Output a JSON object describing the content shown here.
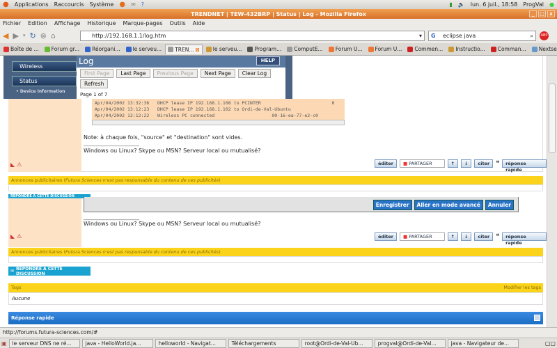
{
  "top_panel": {
    "menus": [
      "Applications",
      "Raccourcis",
      "Système"
    ],
    "clock": "lun.  6 juil., 18:58",
    "user": "ProgVal"
  },
  "window": {
    "title": "TRENDNET | TEW-432BRP | Status | Log - Mozilla Firefox"
  },
  "menubar": [
    "Fichier",
    "Edition",
    "Affichage",
    "Historique",
    "Marque-pages",
    "Outils",
    "Aide"
  ],
  "navbar": {
    "url": "http://192.168.1.1/log.htm",
    "search_value": "eclipse java"
  },
  "tabs": [
    {
      "label": "Boîte de ...",
      "color": "#d33"
    },
    {
      "label": "Forum gr...",
      "color": "#6b3"
    },
    {
      "label": "Réorgani...",
      "color": "#36c"
    },
    {
      "label": "le serveu...",
      "color": "#36c"
    },
    {
      "label": "TREN...",
      "color": "#999",
      "active": true
    },
    {
      "label": "le serveu...",
      "color": "#c93"
    },
    {
      "label": "Program...",
      "color": "#555"
    },
    {
      "label": "ComputE...",
      "color": "#999"
    },
    {
      "label": "Forum U...",
      "color": "#e73"
    },
    {
      "label": "Forum U...",
      "color": "#e73"
    },
    {
      "label": "Commen...",
      "color": "#c22"
    },
    {
      "label": "Instructio...",
      "color": "#c93"
    },
    {
      "label": "Comman...",
      "color": "#c22"
    },
    {
      "label": "Nextsend",
      "color": "#69c"
    }
  ],
  "router": {
    "nav": [
      "Wireless",
      "Status"
    ],
    "subnav": "• Device Information",
    "header": "Log",
    "help": "HELP",
    "buttons": [
      {
        "label": "First Page",
        "disabled": true
      },
      {
        "label": "Last Page"
      },
      {
        "label": "Previous Page",
        "disabled": true
      },
      {
        "label": "Next Page"
      },
      {
        "label": "Clear Log"
      },
      {
        "label": "Refresh"
      }
    ],
    "page_info": "Page 1 of 7"
  },
  "log_lines": [
    "Apr/04/2002 13:32:36   DHCP lease IP 192.168.1.108 to PCINTER                          0",
    "Apr/04/2002 13:12:23   DHCP lease IP 192.168.1.102 to Ordi-de-Val-Ubuntu",
    "Apr/04/2002 13:12:22   Wireless PC connected                     00-16-ea-77-e2-c0"
  ],
  "post1": {
    "note": "Note: à chaque fois, \"source\" et \"destination\" sont vides.",
    "signature_sep": "____________________",
    "signature": "Windows ou Linux? Skype ou MSN? Serveur local ou mutualisé?"
  },
  "post_actions": {
    "edit": "éditer",
    "share": "PARTAGER",
    "quote": "citer",
    "quick_reply": "réponse rapide"
  },
  "ads": {
    "label": "Annonces publicitaires (",
    "italic": "Futura Sciences n'est pas responsable du contenu de ces publicités",
    "close": ")"
  },
  "editor": {
    "save": "Enregistrer",
    "advanced": "Aller en mode avancé",
    "cancel": "Annuler"
  },
  "reply_button": "RÉPONDRE À CETTE DISCUSSION",
  "tags": {
    "title": "Tags",
    "edit": "Modifier les tags",
    "value": "Aucune"
  },
  "quick_reply_bar": "Réponse rapide",
  "statusbar": "http://forums.futura-sciences.com/#",
  "taskbar": [
    "le serveur DNS ne ré...",
    "java - HelloWorld.ja...",
    "helloworld - Navigat...",
    "Téléchargements",
    "root@Ordi-de-Val-Ub...",
    "progval@Ordi-de-Val...",
    "java - Navigateur de..."
  ]
}
